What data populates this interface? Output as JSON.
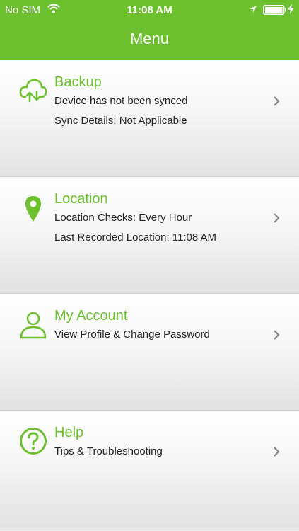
{
  "status_bar": {
    "carrier": "No SIM",
    "time": "11:08 AM",
    "icons": [
      "wifi-icon",
      "location-arrow-icon",
      "battery-icon",
      "charging-bolt-icon"
    ]
  },
  "header": {
    "title": "Menu"
  },
  "menu": {
    "items": [
      {
        "label": "Backup",
        "icon": "cloud-sync-icon",
        "lines": [
          "Device has not been synced",
          "Sync Details: Not Applicable"
        ]
      },
      {
        "label": "Location",
        "icon": "map-pin-icon",
        "lines": [
          "Location Checks: Every Hour",
          "Last Recorded Location: 11:08 AM"
        ]
      },
      {
        "label": "My Account",
        "icon": "user-icon",
        "lines": [
          "View Profile & Change Password"
        ]
      },
      {
        "label": "Help",
        "icon": "question-circle-icon",
        "lines": [
          "Tips & Troubleshooting"
        ]
      }
    ]
  },
  "colors": {
    "accent": "#6cc02e",
    "header_text": "#ffffff",
    "body_text": "#222222",
    "chevron": "#888888"
  }
}
